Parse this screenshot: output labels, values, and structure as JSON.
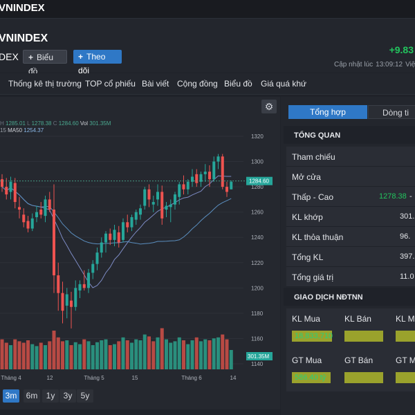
{
  "topbar": {
    "title": "VNINDEX"
  },
  "header": {
    "name": "VNINDEX",
    "symbol": "DEX",
    "chart_button": "Biểu đồ",
    "follow_button": "Theo dõi",
    "change": "+9.83",
    "updated_label": "Cập nhật lúc",
    "updated_time": "13:09:12",
    "updated_tail": "Việt N"
  },
  "nav": [
    "Thống kê thị trường",
    "TOP cổ phiếu",
    "Bài viết",
    "Cộng đồng",
    "Biểu đồ",
    "Giá quá khứ"
  ],
  "legend": {
    "line1_prefix": "",
    "h_label": "H",
    "h_value": "1285.01",
    "l_label": "L",
    "l_value": "1278.38",
    "c_label": "C",
    "c_value": "1284.60",
    "vol_label": "Vol",
    "vol_value": "301.35M",
    "line2_prefix": "15",
    "ma_label": "MA50",
    "ma_value": "1254.37"
  },
  "ranges": [
    "3m",
    "6m",
    "1y",
    "3y",
    "5y"
  ],
  "active_range": "3m",
  "side_tabs": [
    "Tổng hợp",
    "Dòng ti"
  ],
  "overview": {
    "title": "TỔNG QUAN",
    "rows": [
      {
        "label": "Tham chiếu",
        "value": ""
      },
      {
        "label": "Mở cửa",
        "value": ""
      },
      {
        "label": "Thấp - Cao",
        "value": "1278.38",
        "value2": "-"
      },
      {
        "label": "KL khớp",
        "value": "301."
      },
      {
        "label": "KL thỏa thuận",
        "value": "96."
      },
      {
        "label": "Tổng KL",
        "value": "397."
      },
      {
        "label": "Tổng giá trị",
        "value": "11.0"
      }
    ]
  },
  "foreign": {
    "title": "GIAO DỊCH NĐTNN",
    "row1": {
      "labels": [
        "KL Mua",
        "KL Bán",
        "KL Mu"
      ],
      "values": [
        "18,833,710",
        "",
        ""
      ]
    },
    "row2": {
      "labels": [
        "GT Mua",
        "GT Bán",
        "GT Mu"
      ],
      "values": [
        "586.40 tỷ",
        "",
        ""
      ]
    }
  },
  "colors": {
    "up": "#26a69a",
    "down": "#ef5350",
    "accent": "#2f78c6",
    "positive": "#22c55e"
  },
  "chart_data": {
    "type": "candlestick",
    "y_ticks": [
      1320,
      1300,
      1280,
      1260,
      1240,
      1220,
      1200,
      1180,
      1160,
      1140
    ],
    "x_ticks": [
      "Tháng 4",
      "12",
      "Tháng 5",
      "15",
      "Tháng 6",
      "14"
    ],
    "last_price_label": "1284.60",
    "last_volume_label": "301.35M",
    "ylim": [
      1140,
      1325
    ],
    "candles": [
      {
        "o": 1286,
        "h": 1290,
        "l": 1276,
        "c": 1280
      },
      {
        "o": 1280,
        "h": 1287,
        "l": 1270,
        "c": 1274
      },
      {
        "o": 1276,
        "h": 1288,
        "l": 1270,
        "c": 1284
      },
      {
        "o": 1283,
        "h": 1287,
        "l": 1263,
        "c": 1268
      },
      {
        "o": 1264,
        "h": 1272,
        "l": 1255,
        "c": 1262
      },
      {
        "o": 1258,
        "h": 1263,
        "l": 1248,
        "c": 1252
      },
      {
        "o": 1253,
        "h": 1257,
        "l": 1244,
        "c": 1247
      },
      {
        "o": 1247,
        "h": 1259,
        "l": 1245,
        "c": 1255
      },
      {
        "o": 1256,
        "h": 1265,
        "l": 1252,
        "c": 1260
      },
      {
        "o": 1262,
        "h": 1268,
        "l": 1255,
        "c": 1258
      },
      {
        "o": 1257,
        "h": 1273,
        "l": 1252,
        "c": 1270
      },
      {
        "o": 1270,
        "h": 1276,
        "l": 1260,
        "c": 1262
      },
      {
        "o": 1262,
        "h": 1282,
        "l": 1196,
        "c": 1210
      },
      {
        "o": 1210,
        "h": 1220,
        "l": 1182,
        "c": 1196
      },
      {
        "o": 1196,
        "h": 1205,
        "l": 1172,
        "c": 1182
      },
      {
        "o": 1186,
        "h": 1200,
        "l": 1176,
        "c": 1195
      },
      {
        "o": 1190,
        "h": 1197,
        "l": 1168,
        "c": 1185
      },
      {
        "o": 1185,
        "h": 1206,
        "l": 1182,
        "c": 1200
      },
      {
        "o": 1198,
        "h": 1206,
        "l": 1192,
        "c": 1203
      },
      {
        "o": 1203,
        "h": 1214,
        "l": 1198,
        "c": 1200
      },
      {
        "o": 1200,
        "h": 1215,
        "l": 1196,
        "c": 1212
      },
      {
        "o": 1212,
        "h": 1222,
        "l": 1207,
        "c": 1219
      },
      {
        "o": 1219,
        "h": 1232,
        "l": 1214,
        "c": 1228
      },
      {
        "o": 1228,
        "h": 1240,
        "l": 1224,
        "c": 1236
      },
      {
        "o": 1236,
        "h": 1245,
        "l": 1228,
        "c": 1243
      },
      {
        "o": 1243,
        "h": 1247,
        "l": 1234,
        "c": 1238
      },
      {
        "o": 1238,
        "h": 1250,
        "l": 1233,
        "c": 1246
      },
      {
        "o": 1244,
        "h": 1249,
        "l": 1232,
        "c": 1236
      },
      {
        "o": 1238,
        "h": 1255,
        "l": 1236,
        "c": 1252
      },
      {
        "o": 1252,
        "h": 1258,
        "l": 1244,
        "c": 1248
      },
      {
        "o": 1248,
        "h": 1258,
        "l": 1245,
        "c": 1256
      },
      {
        "o": 1254,
        "h": 1262,
        "l": 1250,
        "c": 1260
      },
      {
        "o": 1258,
        "h": 1266,
        "l": 1254,
        "c": 1263
      },
      {
        "o": 1265,
        "h": 1280,
        "l": 1262,
        "c": 1278
      },
      {
        "o": 1278,
        "h": 1282,
        "l": 1264,
        "c": 1270
      },
      {
        "o": 1266,
        "h": 1273,
        "l": 1260,
        "c": 1268
      },
      {
        "o": 1270,
        "h": 1282,
        "l": 1265,
        "c": 1276
      },
      {
        "o": 1276,
        "h": 1281,
        "l": 1250,
        "c": 1255
      },
      {
        "o": 1262,
        "h": 1268,
        "l": 1256,
        "c": 1265
      },
      {
        "o": 1264,
        "h": 1270,
        "l": 1252,
        "c": 1266
      },
      {
        "o": 1266,
        "h": 1276,
        "l": 1262,
        "c": 1274
      },
      {
        "o": 1272,
        "h": 1284,
        "l": 1266,
        "c": 1282
      },
      {
        "o": 1282,
        "h": 1289,
        "l": 1274,
        "c": 1278
      },
      {
        "o": 1278,
        "h": 1286,
        "l": 1274,
        "c": 1284
      },
      {
        "o": 1284,
        "h": 1294,
        "l": 1280,
        "c": 1288
      },
      {
        "o": 1290,
        "h": 1294,
        "l": 1280,
        "c": 1283
      },
      {
        "o": 1284,
        "h": 1292,
        "l": 1280,
        "c": 1290
      },
      {
        "o": 1290,
        "h": 1298,
        "l": 1284,
        "c": 1292
      },
      {
        "o": 1292,
        "h": 1297,
        "l": 1280,
        "c": 1286
      },
      {
        "o": 1286,
        "h": 1304,
        "l": 1284,
        "c": 1300
      },
      {
        "o": 1300,
        "h": 1306,
        "l": 1294,
        "c": 1304
      },
      {
        "o": 1304,
        "h": 1306,
        "l": 1278,
        "c": 1280
      },
      {
        "o": 1280,
        "h": 1284,
        "l": 1272,
        "c": 1276
      },
      {
        "o": 1278,
        "h": 1285,
        "l": 1278,
        "c": 1284
      }
    ],
    "volumes": [
      {
        "v": 0.62,
        "up": false
      },
      {
        "v": 0.55,
        "up": false
      },
      {
        "v": 0.5,
        "up": true
      },
      {
        "v": 0.62,
        "up": false
      },
      {
        "v": 0.58,
        "up": false
      },
      {
        "v": 0.55,
        "up": false
      },
      {
        "v": 0.6,
        "up": false
      },
      {
        "v": 0.52,
        "up": true
      },
      {
        "v": 0.48,
        "up": true
      },
      {
        "v": 0.55,
        "up": false
      },
      {
        "v": 0.5,
        "up": true
      },
      {
        "v": 0.58,
        "up": false
      },
      {
        "v": 0.8,
        "up": false
      },
      {
        "v": 0.66,
        "up": false
      },
      {
        "v": 0.58,
        "up": false
      },
      {
        "v": 0.6,
        "up": true
      },
      {
        "v": 0.5,
        "up": false
      },
      {
        "v": 0.56,
        "up": true
      },
      {
        "v": 0.52,
        "up": true
      },
      {
        "v": 0.62,
        "up": false
      },
      {
        "v": 0.58,
        "up": true
      },
      {
        "v": 0.5,
        "up": true
      },
      {
        "v": 0.56,
        "up": true
      },
      {
        "v": 0.6,
        "up": true
      },
      {
        "v": 0.62,
        "up": true
      },
      {
        "v": 0.5,
        "up": false
      },
      {
        "v": 0.52,
        "up": true
      },
      {
        "v": 0.58,
        "up": false
      },
      {
        "v": 0.66,
        "up": true
      },
      {
        "v": 0.6,
        "up": false
      },
      {
        "v": 0.55,
        "up": true
      },
      {
        "v": 0.62,
        "up": true
      },
      {
        "v": 0.6,
        "up": true
      },
      {
        "v": 0.72,
        "up": true
      },
      {
        "v": 0.68,
        "up": false
      },
      {
        "v": 0.58,
        "up": false
      },
      {
        "v": 0.66,
        "up": true
      },
      {
        "v": 0.85,
        "up": false
      },
      {
        "v": 0.62,
        "up": true
      },
      {
        "v": 0.55,
        "up": true
      },
      {
        "v": 0.58,
        "up": true
      },
      {
        "v": 0.66,
        "up": true
      },
      {
        "v": 0.6,
        "up": false
      },
      {
        "v": 0.52,
        "up": true
      },
      {
        "v": 0.6,
        "up": true
      },
      {
        "v": 0.66,
        "up": false
      },
      {
        "v": 0.58,
        "up": true
      },
      {
        "v": 0.62,
        "up": true
      },
      {
        "v": 0.6,
        "up": false
      },
      {
        "v": 0.64,
        "up": true
      },
      {
        "v": 0.66,
        "up": true
      },
      {
        "v": 0.72,
        "up": false
      },
      {
        "v": 0.62,
        "up": false
      },
      {
        "v": 0.4,
        "up": true
      }
    ]
  }
}
